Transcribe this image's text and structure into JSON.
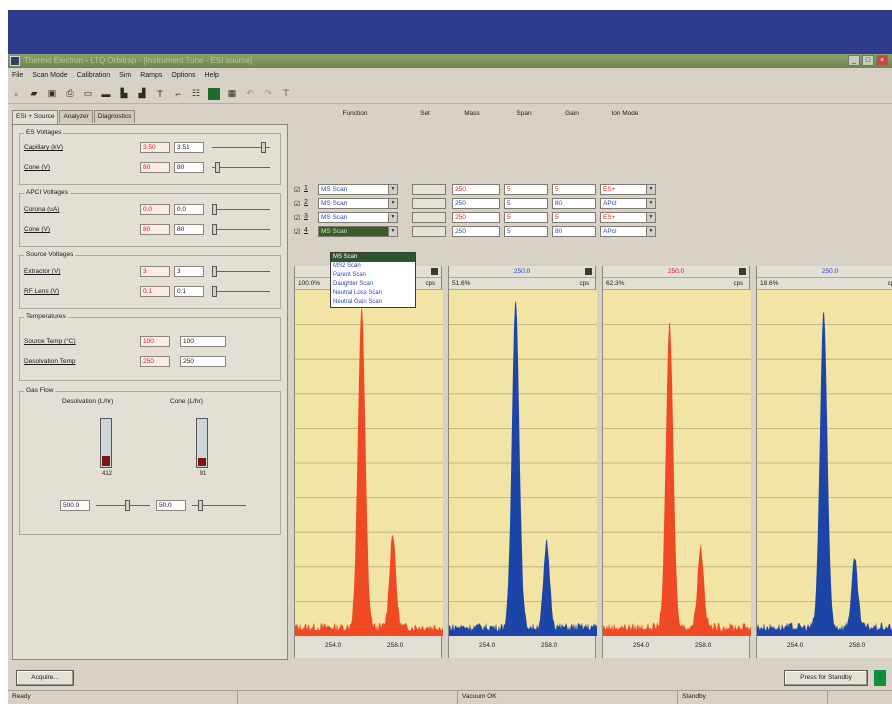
{
  "window": {
    "title": "Thermo Electron - LTQ Orbitrap - [Instrument Tune - ESI source]",
    "minimize": "_",
    "maximize": "□",
    "close": "×"
  },
  "menu": [
    "File",
    "Scan Mode",
    "Calibration",
    "Sim",
    "Ramps",
    "Options",
    "Help"
  ],
  "toolbar": [
    "new-icon",
    "open-icon",
    "save-icon",
    "print-icon",
    "copy-icon",
    "camera-icon",
    "tree-icon",
    "chart-icon",
    "tune-icon",
    "divert-icon",
    "mz-icon",
    "stop-icon",
    "graph-icon",
    "undo-icon",
    "redo-icon",
    "pin-icon"
  ],
  "tabs": [
    "ESI + Source",
    "Analyzer",
    "Diagnostics"
  ],
  "source": {
    "es_voltages": {
      "title": "ES Voltages",
      "rows": [
        {
          "label": "Capillary (kV)",
          "set": "3.50",
          "read": "3.51",
          "level": 0.92
        },
        {
          "label": "Cone (V)",
          "set": "80",
          "read": "80",
          "level": 0.06
        }
      ]
    },
    "apci_voltages": {
      "title": "APCI Voltages",
      "rows": [
        {
          "label": "Corona (uA)",
          "set": "0.0",
          "read": "0.0",
          "level": 0.0
        },
        {
          "label": "Cone (V)",
          "set": "80",
          "read": "80",
          "level": 0.0
        }
      ]
    },
    "source_voltages": {
      "title": "Source Voltages",
      "rows": [
        {
          "label": "Extractor (V)",
          "set": "3",
          "read": "3",
          "level": 0.0
        },
        {
          "label": "RF Lens (V)",
          "set": "0.1",
          "read": "0.1",
          "level": 0.0
        }
      ]
    },
    "temperatures": {
      "title": "Temperatures",
      "rows": [
        {
          "label": "Source Temp (°C)",
          "set": "100",
          "read": "100"
        },
        {
          "label": "Desolvation Temp",
          "set": "250",
          "read": "250"
        }
      ]
    },
    "gas_flow": {
      "title": "Gas Flow",
      "desolvation_label": "Desolvation (L/hr)",
      "cone_label": "Cone (L/hr)",
      "desolvation_reading": "412",
      "cone_reading": "91",
      "desolvation_fill": 0.2,
      "cone_fill": 0.16,
      "desolvation_value": "500.0",
      "cone_value": "50.0",
      "desolvation_level": 0.6,
      "cone_level": 0.12
    }
  },
  "scan_table": {
    "headers": {
      "function": "Function",
      "set": "Set",
      "mass": "Mass",
      "span": "Span",
      "gain": "Gain",
      "ion_mode": "Ion Mode"
    },
    "rows": [
      {
        "idx": "1",
        "function": "MS Scan",
        "set": "",
        "mass": "250",
        "span": "5",
        "gain": "5",
        "ion_mode": "ES+"
      },
      {
        "idx": "2",
        "function": "MS Scan",
        "set": "",
        "mass": "250",
        "span": "5",
        "gain": "80",
        "ion_mode": "APcI"
      },
      {
        "idx": "3",
        "function": "MS Scan",
        "set": "",
        "mass": "250",
        "span": "5",
        "gain": "5",
        "ion_mode": "ES+"
      },
      {
        "idx": "4",
        "function": "MS Scan",
        "set": "",
        "mass": "250",
        "span": "5",
        "gain": "80",
        "ion_mode": "APcI"
      }
    ],
    "dropdown_options": [
      "MS Scan",
      "MS2 Scan",
      "Parent Scan",
      "Daughter Scan",
      "Neutral Loss Scan",
      "Neutral Gain Scan"
    ],
    "dropdown_selected_index": 0
  },
  "spectra": [
    {
      "mass": "250.0",
      "intensity": "100.0%",
      "unit": "cps",
      "color": "#f04a25",
      "ticks": [
        "254.0",
        "258.0"
      ],
      "peak_a": 0.95,
      "peak_b": 0.28
    },
    {
      "mass": "250.0",
      "intensity": "51.6%",
      "unit": "cps",
      "color": "#1d45a8",
      "ticks": [
        "254.0",
        "258.0"
      ],
      "peak_a": 0.98,
      "peak_b": 0.25
    },
    {
      "mass": "250.0",
      "intensity": "62.3%",
      "unit": "cps",
      "color": "#f04a25",
      "ticks": [
        "254.0",
        "258.0"
      ],
      "peak_a": 0.9,
      "peak_b": 0.24
    },
    {
      "mass": "250.0",
      "intensity": "18.6%",
      "unit": "cps",
      "color": "#1d45a8",
      "ticks": [
        "254.0",
        "258.0"
      ],
      "peak_a": 0.94,
      "peak_b": 0.2
    }
  ],
  "buttons": {
    "acquire": "Acquire...",
    "standby": "Press for Standby"
  },
  "status": [
    "Ready",
    "",
    "Vacuum OK",
    "Standby",
    ""
  ]
}
